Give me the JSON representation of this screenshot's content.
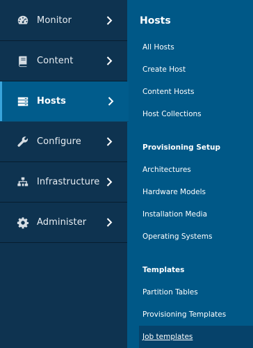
{
  "nav": {
    "items": [
      {
        "label": "Monitor",
        "icon": "dashboard-icon"
      },
      {
        "label": "Content",
        "icon": "book-icon"
      },
      {
        "label": "Hosts",
        "icon": "server-icon",
        "active": true
      },
      {
        "label": "Configure",
        "icon": "wrench-icon"
      },
      {
        "label": "Infrastructure",
        "icon": "sitemap-icon"
      },
      {
        "label": "Administer",
        "icon": "gear-icon"
      }
    ]
  },
  "submenu": {
    "title": "Hosts",
    "links_hosts": [
      "All Hosts",
      "Create Host",
      "Content Hosts",
      "Host Collections"
    ],
    "provisioning_heading": "Provisioning Setup",
    "links_provisioning": [
      "Architectures",
      "Hardware Models",
      "Installation Media",
      "Operating Systems"
    ],
    "templates_heading": "Templates",
    "links_templates": [
      "Partition Tables",
      "Provisioning Templates",
      "Job templates"
    ],
    "selected": "Job templates"
  },
  "colors": {
    "sidebar_bg": "#0e3350",
    "active_bg": "#015c8c",
    "submenu_bg": "#005887",
    "accent": "#39a5dc"
  }
}
